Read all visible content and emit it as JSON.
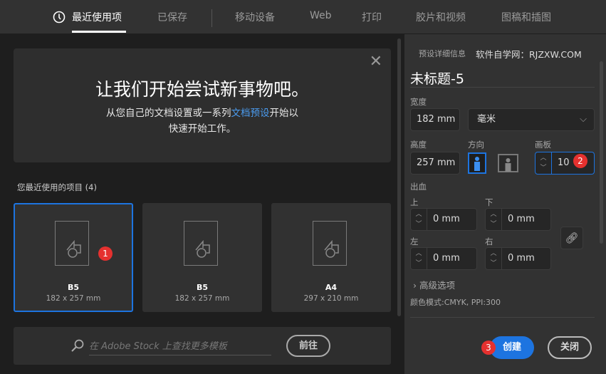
{
  "tabs": [
    "最近使用项",
    "已保存",
    "移动设备",
    "Web",
    "打印",
    "胶片和视频",
    "图稿和插图"
  ],
  "hero": {
    "title": "让我们开始尝试新事物吧。",
    "line1a": "从您自己的文档设置或一系列",
    "link": "文档预设",
    "line1b": "开始以",
    "line2": "快速开始工作。"
  },
  "recent": {
    "label": "您最近使用的项目",
    "count": "(4)",
    "items": [
      {
        "name": "B5",
        "size": "182 x 257 mm"
      },
      {
        "name": "B5",
        "size": "182 x 257 mm"
      },
      {
        "name": "A4",
        "size": "297 x 210 mm"
      }
    ]
  },
  "search": {
    "placeholder": "在 Adobe Stock 上查找更多模板",
    "go": "前往"
  },
  "panel": {
    "header": "预设详细信息",
    "watermark": "软件自学网：RJZXW.COM",
    "doc_title": "未标题-5",
    "width_label": "宽度",
    "width": "182 mm",
    "unit": "毫米",
    "height_label": "高度",
    "height": "257 mm",
    "orient_label": "方向",
    "artboard_label": "画板",
    "artboards": "10",
    "bleed_label": "出血",
    "top_label": "上",
    "bottom_label": "下",
    "left_label": "左",
    "right_label": "右",
    "top": "0 mm",
    "bottom": "0 mm",
    "left": "0 mm",
    "right": "0 mm",
    "advanced": "高级选项",
    "color_mode": "颜色模式:CMYK, PPI:300",
    "create": "创建",
    "close": "关闭"
  },
  "badges": [
    "1",
    "2",
    "3"
  ],
  "colors": {
    "accent": "#1d74e0",
    "badge": "#e5312f"
  }
}
